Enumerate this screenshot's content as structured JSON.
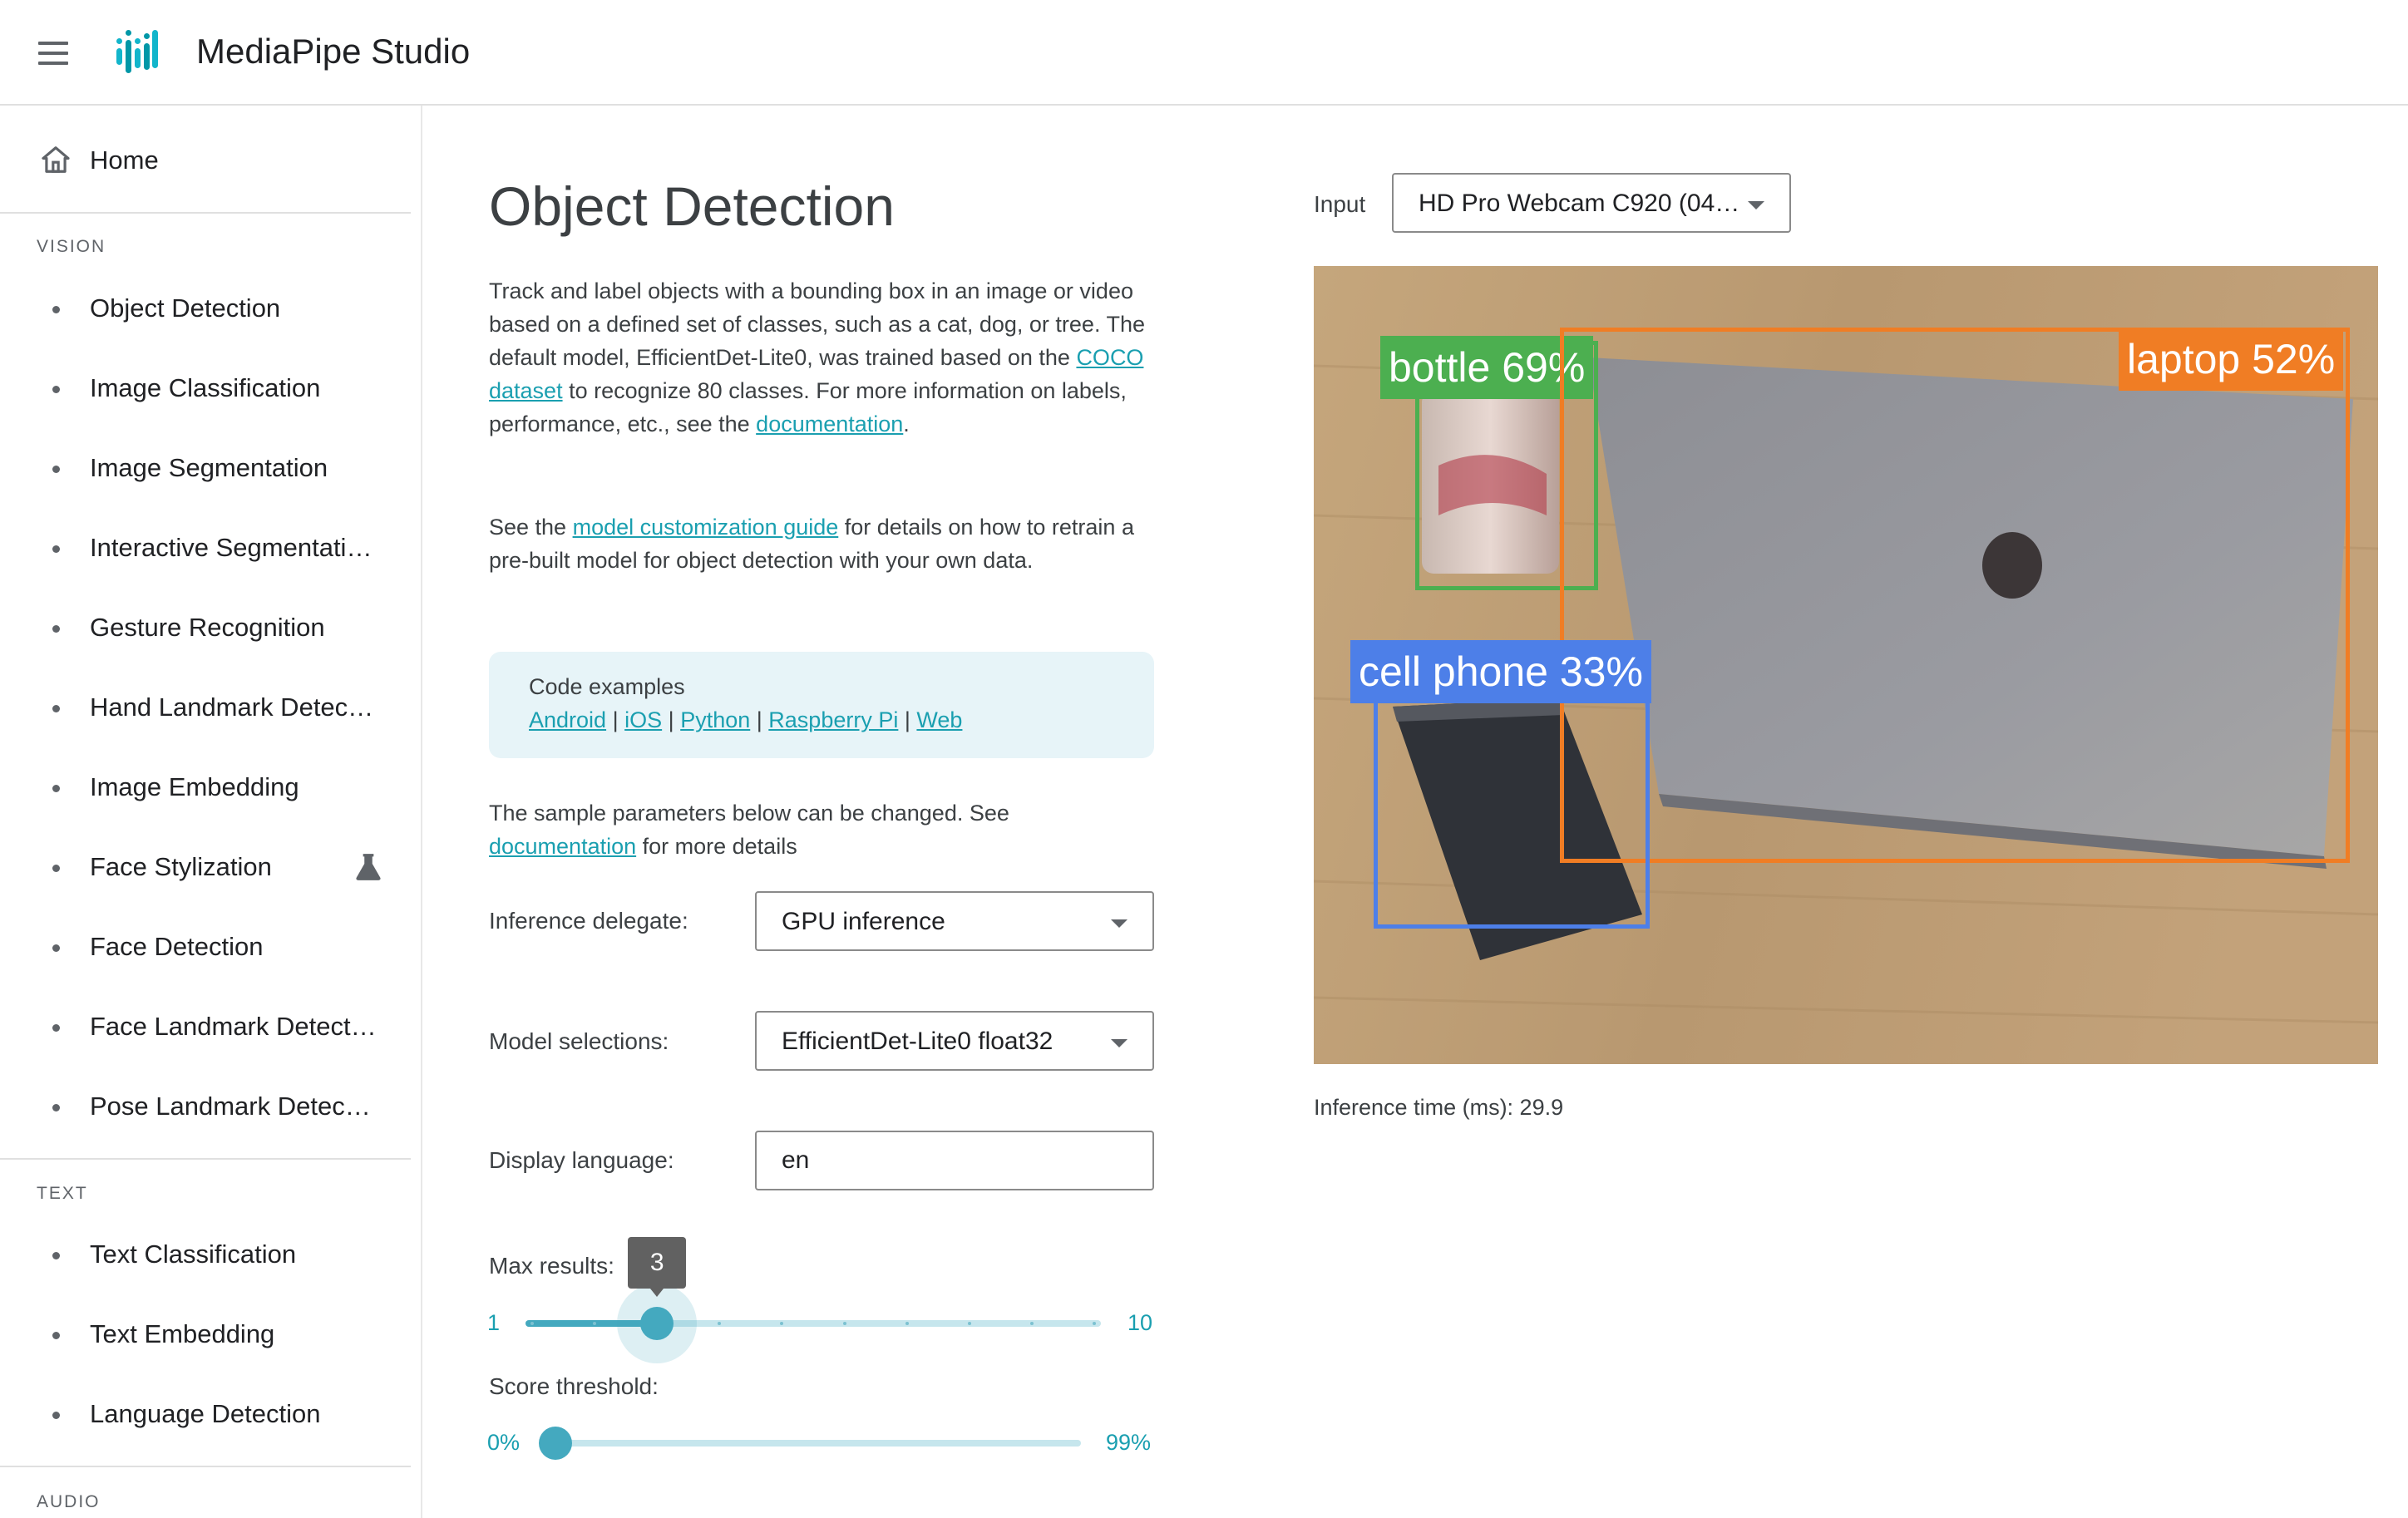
{
  "app": {
    "title": "MediaPipe Studio"
  },
  "sidebar": {
    "home": "Home",
    "vision_title": "VISION",
    "vision_items": [
      "Object Detection",
      "Image Classification",
      "Image Segmentation",
      "Interactive Segmentati…",
      "Gesture Recognition",
      "Hand Landmark Detec…",
      "Image Embedding",
      "Face Stylization",
      "Face Detection",
      "Face Landmark Detect…",
      "Pose Landmark Detec…"
    ],
    "text_title": "TEXT",
    "text_items": [
      "Text Classification",
      "Text Embedding",
      "Language Detection"
    ],
    "audio_title": "AUDIO"
  },
  "main": {
    "title": "Object Detection",
    "desc": {
      "p1_before": "Track and label objects with a bounding box in an image or video based on a defined set of classes, such as a cat, dog, or tree. The default model, EfficientDet-Lite0, was trained based on the ",
      "p1_link": "COCO dataset",
      "p1_mid": " to recognize 80 classes. For more information on labels, performance, etc., see the ",
      "p1_link2": "documentation",
      "p1_end": ".",
      "p2_before": "See the ",
      "p2_link": "model customization guide",
      "p2_after": " for details on how to retrain a pre-built model for object detection with your own data."
    },
    "code_examples": {
      "title": "Code examples",
      "links": [
        "Android",
        "iOS",
        "Python",
        "Raspberry Pi",
        "Web"
      ],
      "separator": "|"
    },
    "params_note": {
      "before": "The sample parameters below can be changed. See ",
      "link": "documentation",
      "after": " for more details"
    },
    "inference_delegate": {
      "label": "Inference delegate:",
      "value": "GPU inference"
    },
    "model_selection": {
      "label": "Model selections:",
      "value": "EfficientDet-Lite0 float32"
    },
    "display_language": {
      "label": "Display language:",
      "value": "en"
    },
    "max_results": {
      "label": "Max results:",
      "min": "1",
      "max": "10",
      "value": 3,
      "min_value": 1,
      "max_value": 10
    },
    "score_threshold": {
      "label": "Score threshold:",
      "min": "0%",
      "max": "99%",
      "value": 0,
      "min_value": 0,
      "max_value": 99
    }
  },
  "right_panel": {
    "input_label": "Input",
    "input_value": "HD Pro Webcam C920 (04…",
    "detections": [
      {
        "label": "bottle 69%",
        "color": "#4caf50"
      },
      {
        "label": "laptop 52%",
        "color": "#f07d24"
      },
      {
        "label": "cell phone 33%",
        "color": "#4d7fe8"
      }
    ],
    "inference_time": "Inference time (ms): 29.9"
  },
  "colors": {
    "accent": "#44a9bf",
    "link": "#1a9fb0",
    "code_box_bg": "#e7f4f8"
  }
}
